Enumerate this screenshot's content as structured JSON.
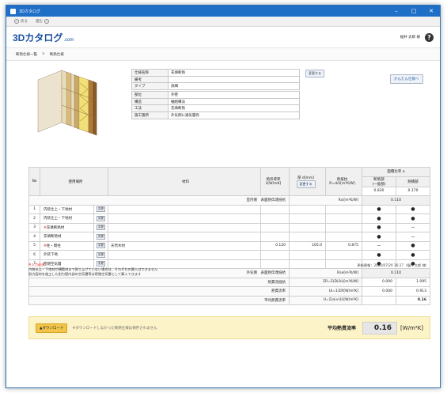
{
  "window": {
    "title": "3Dカタログ"
  },
  "nav": {
    "back": "戻る",
    "forward": "進む"
  },
  "header": {
    "logo_main": "3Dカタログ",
    "logo_suffix": ".com",
    "user": "福井 太郎 様",
    "help": "?"
  },
  "breadcrumb": {
    "items": [
      "断熱仕様一覧",
      ">",
      "断熱仕様"
    ]
  },
  "spec": {
    "rows1": [
      {
        "k": "仕様名称",
        "v": "充填断熱"
      },
      {
        "k": "備考",
        "v": ""
      },
      {
        "k": "タイプ",
        "v": "詳細"
      }
    ],
    "rows2": [
      {
        "k": "部位",
        "v": "外壁"
      },
      {
        "k": "構造",
        "v": "軸組構法"
      },
      {
        "k": "工法",
        "v": "充填断熱"
      },
      {
        "k": "施工箇所",
        "v": "外気側に通気層有"
      }
    ],
    "change_button": "変更する",
    "simple_button": "かんたん仕様へ"
  },
  "table": {
    "headers": {
      "no": "No",
      "location": "使用場所",
      "material": "材料",
      "conductivity": "熱伝導率\nλ[W/mK]",
      "thickness": "厚 d[mm]",
      "thickness_btn": "変更する",
      "resistance": "熱抵抗\nR=d/λ[m²K/W]",
      "area_ratio": "面積比率 a",
      "insul": "断熱部\n(一般部)",
      "thermal_bridge": "熱橋部"
    },
    "area_values": [
      "0.830",
      "0.170"
    ],
    "inner_surface": {
      "label": "室内側　表面熱伝達抵抗",
      "unit": "Rsi[m²K/W]",
      "value": "0.110"
    },
    "change_chip": "変更",
    "rows": [
      {
        "no": "1",
        "req": "",
        "loc": "内装仕上・下地材",
        "mat": "",
        "l": "",
        "d": "",
        "r": "",
        "a": "●",
        "b": "●"
      },
      {
        "no": "2",
        "req": "",
        "loc": "内装仕上・下地材",
        "mat": "",
        "l": "",
        "d": "",
        "r": "",
        "a": "●",
        "b": "●"
      },
      {
        "no": "3",
        "req": "※",
        "loc": "充填断熱材",
        "mat": "",
        "l": "",
        "d": "",
        "r": "",
        "a": "●",
        "b": "－"
      },
      {
        "no": "4",
        "req": "",
        "loc": "充填断熱材",
        "mat": "",
        "l": "",
        "d": "",
        "r": "",
        "a": "●",
        "b": "－"
      },
      {
        "no": "5",
        "req": "※",
        "loc": "柱・間柱",
        "mat": "天然木材",
        "l": "0.120",
        "d": "105.0",
        "r": "0.875",
        "a": "－",
        "b": "●"
      },
      {
        "no": "6",
        "req": "",
        "loc": "外装下地",
        "mat": "",
        "l": "",
        "d": "",
        "r": "",
        "a": "●",
        "b": "●"
      },
      {
        "no": "7",
        "req": "",
        "loc": "密閉空気層",
        "mat": "",
        "l": "",
        "d": "",
        "r": "",
        "a": "●",
        "b": "●"
      }
    ],
    "outer_surface": {
      "label": "外気側　表面熱伝達抵抗",
      "unit": "Rse[m²K/W]",
      "value": "0.110"
    },
    "total_res": {
      "label": "熱貫流抵抗",
      "unit": "ΣR=Σ(Di/λi)[m²K/W]",
      "a": "0.000",
      "b": "1.095"
    },
    "heat_trans": {
      "label": "熱貫流率",
      "unit": "Ui=1/ΣR[W/m²K]",
      "a": "0.000",
      "b": "0.913"
    },
    "avg": {
      "label": "平均熱貫流率",
      "unit": "U=Σ(ai×Ui)[W/m²K]",
      "value": "0.16"
    }
  },
  "notes": {
    "required": "※入力必須",
    "line1": "内装仕上・下地材が構築材まで張り上げていない場合は、それぞれの算入はできません",
    "line2": "耐力面材を施工した耐力壁内部の空気層等は密閉空気層として算入できます",
    "updated": "更新情報：2022/07/20 16:27（福井 太郎 様）"
  },
  "footer": {
    "download": "▲ダウンロード",
    "note": "※ダウンロードしなかった断熱仕様は保存されません",
    "avg_label": "平均熱貫流率",
    "avg_value": "0.16",
    "avg_unit": "[W/m²K]"
  }
}
